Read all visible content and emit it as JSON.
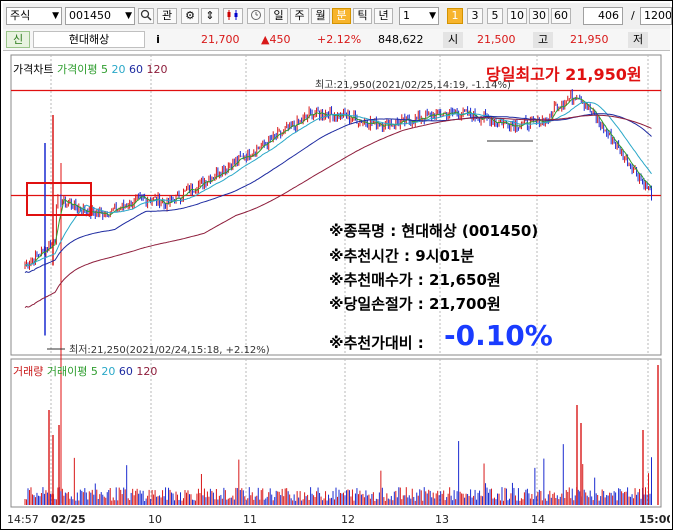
{
  "toolbar": {
    "market_select": "주식",
    "code_input": "001450",
    "search_icon": "search-icon",
    "relation_button": "관",
    "gear_button": "⚙",
    "updown_button": "⇕",
    "period_tabs": [
      "일",
      "주",
      "월",
      "분",
      "틱",
      "년"
    ],
    "active_period": "분",
    "count_select": "1",
    "interval_buttons": [
      "1",
      "3",
      "5",
      "10",
      "30",
      "60"
    ],
    "active_interval": "1",
    "visible_count": "406",
    "slash": "/",
    "total_count": "1200"
  },
  "infobar": {
    "badge": "신",
    "stock_name": "현대해상",
    "info_icon": "i",
    "price": "21,700",
    "change": "▲450",
    "change_pct": "+2.12%",
    "volume": "848,622",
    "open_label": "시",
    "open_value": "21,500",
    "high_label": "고",
    "high_value": "21,950",
    "low_label": "저"
  },
  "price_panel": {
    "legend_title": "가격차트",
    "legend_ma": "가격이평",
    "ma_periods": [
      "5",
      "20",
      "60",
      "120"
    ],
    "ma_colors": [
      "#2e9d2e",
      "#2aa8c8",
      "#1d2aa0",
      "#8e1e3c"
    ],
    "high_annotation": "최고:21,950(2021/02/25,14:19, -1.14%)",
    "high_callout": "당일최고가 21,950원",
    "low_annotation": "최저:21,250(2021/02/24,15:18, +2.12%)"
  },
  "volume_panel": {
    "legend_title": "거래량",
    "legend_ma": "거래이평",
    "ma_periods": [
      "5",
      "20",
      "60",
      "120"
    ]
  },
  "notes": {
    "line1": "※종목명 : 현대해상 (001450)",
    "line2": "※추천시간 : 9시01분",
    "line3": "※추천매수가 : 21,650원",
    "line4": "※당일손절가 : 21,700원",
    "line5_label": "※추천가대비 :",
    "line5_value": "-0.10%",
    "highlight_color": "#1a3cff"
  },
  "x_axis": {
    "labels": [
      "14:57",
      "02/25",
      "10",
      "11",
      "12",
      "13",
      "14",
      "15:00"
    ]
  },
  "colors": {
    "up": "#d81818",
    "down": "#1a2bd0",
    "callout_red": "#e01010"
  }
}
